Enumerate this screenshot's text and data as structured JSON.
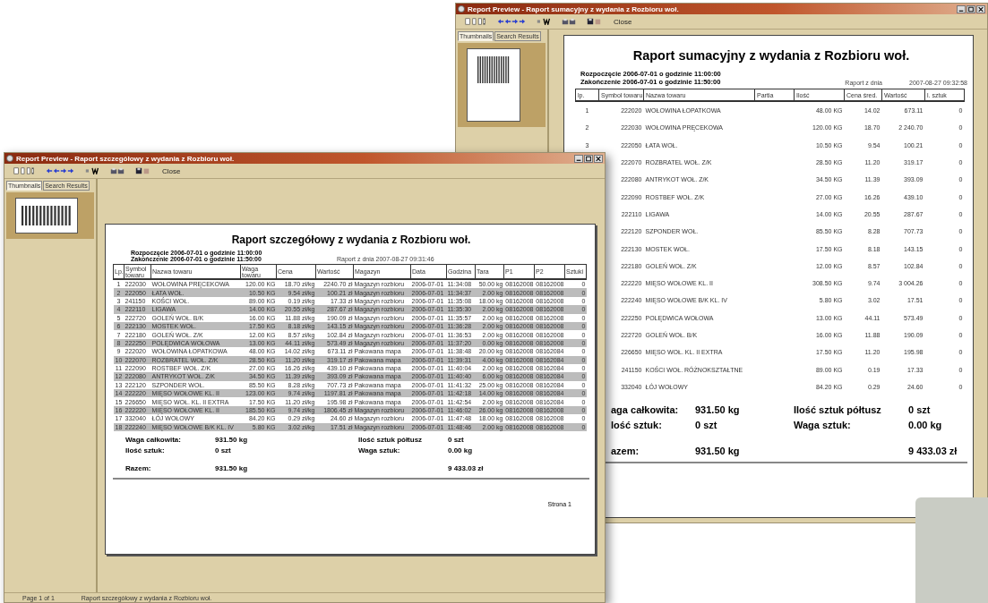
{
  "back_window": {
    "title": "Report Preview - Raport sumacyjny z wydania z Rozbioru woł.",
    "close_label": "Close",
    "tabs": [
      {
        "label": "Thumbnails",
        "selected": true
      },
      {
        "label": "Search Results",
        "selected": false
      }
    ],
    "report": {
      "title": "Raport sumacyjny z wydania z Rozbioru woł.",
      "start": "Rozpoczęcie 2006-07-01 o godzinie 11:00:00",
      "end": "Zakończenie 2006-07-01 o godzinie 11:50:00",
      "date_label": "Raport z dnia",
      "date": "2007-08-27 09:32:58",
      "columns": [
        "lp.",
        "Symbol towaru",
        "Nazwa towaru",
        "Partia",
        "Ilość",
        "Cena śred.",
        "Wartość",
        "l. sztuk"
      ],
      "rows": [
        [
          "1",
          "222020",
          "WOŁOWINA ŁOPATKOWA",
          "",
          "48.00 KG",
          "14.02",
          "673.11",
          "0"
        ],
        [
          "2",
          "222030",
          "WOŁOWINA PRĘCEKOWA",
          "",
          "120.00 KG",
          "18.70",
          "2 240.70",
          "0"
        ],
        [
          "3",
          "222050",
          "ŁATA WOŁ.",
          "",
          "10.50 KG",
          "9.54",
          "100.21",
          "0"
        ],
        [
          "",
          "222070",
          "ROZBRATEL WOŁ. Z/K",
          "",
          "28.50 KG",
          "11.20",
          "319.17",
          "0"
        ],
        [
          "",
          "222080",
          "ANTRYKOT WOŁ. Z/K",
          "",
          "34.50 KG",
          "11.39",
          "393.09",
          "0"
        ],
        [
          "",
          "222090",
          "ROSTBEF WOŁ. Z/K",
          "",
          "27.00 KG",
          "16.26",
          "439.10",
          "0"
        ],
        [
          "",
          "222110",
          "LIGAWA",
          "",
          "14.00 KG",
          "20.55",
          "287.67",
          "0"
        ],
        [
          "",
          "222120",
          "SZPONDER WOŁ.",
          "",
          "85.50 KG",
          "8.28",
          "707.73",
          "0"
        ],
        [
          "",
          "222130",
          "MOSTEK WOŁ.",
          "",
          "17.50 KG",
          "8.18",
          "143.15",
          "0"
        ],
        [
          "",
          "222180",
          "GOLEŃ WOŁ. Z/K",
          "",
          "12.00 KG",
          "8.57",
          "102.84",
          "0"
        ],
        [
          "",
          "222220",
          "MIĘSO WOŁOWE KL. II",
          "",
          "308.50 KG",
          "9.74",
          "3 004.26",
          "0"
        ],
        [
          "",
          "222240",
          "MIĘSO WOŁOWE B/K KL. IV",
          "",
          "5.80 KG",
          "3.02",
          "17.51",
          "0"
        ],
        [
          "",
          "222250",
          "POLĘDWICA WOŁOWA",
          "",
          "13.00 KG",
          "44.11",
          "573.49",
          "0"
        ],
        [
          "",
          "222720",
          "GOLEŃ WOŁ. B/K",
          "",
          "16.00 KG",
          "11.88",
          "190.09",
          "0"
        ],
        [
          "",
          "226650",
          "MIĘSO WOŁ. KL. II EXTRA",
          "",
          "17.50 KG",
          "11.20",
          "195.98",
          "0"
        ],
        [
          "",
          "241150",
          "KOŚCI WOŁ. RÓŻNOKSZTAŁTNE",
          "",
          "89.00 KG",
          "0.19",
          "17.33",
          "0"
        ],
        [
          "",
          "332040",
          "ŁÓJ WOŁOWY",
          "",
          "84.20 KG",
          "0.29",
          "24.60",
          "0"
        ]
      ],
      "summary": [
        {
          "left_label": "aga całkowita:",
          "left_value": "931.50 kg",
          "right_label": "Ilość sztuk półtusz",
          "right_value": "0 szt"
        },
        {
          "left_label": "lość sztuk:",
          "left_value": "0 szt",
          "right_label": "Waga sztuk:",
          "right_value": "0.00 kg"
        },
        {
          "left_label": "azem:",
          "left_value": "931.50 kg",
          "right_value": "9 433.03 zł"
        }
      ]
    }
  },
  "front_window": {
    "title": "Report Preview - Raport szczegółowy z wydania z Rozbioru woł.",
    "close_label": "Close",
    "tabs": [
      {
        "label": "Thumbnails",
        "selected": true
      },
      {
        "label": "Search Results",
        "selected": false
      }
    ],
    "report": {
      "title": "Raport szczegółowy z wydania z Rozbioru woł.",
      "start": "Rozpoczęcie 2006-07-01 o godzinie 11:00:00",
      "end": "Zakończenie 2006-07-01 o godzinie 11:50:00",
      "date_line": "Raport z dnia 2007-08-27 09:31:46",
      "columns": [
        "Lp.",
        "Symbol towaru",
        "Nazwa towaru",
        "Waga towaru",
        "Cena",
        "Wartość",
        "Magazyn",
        "Data",
        "Godzina",
        "Tara",
        "P1",
        "P2",
        "Sztuki"
      ],
      "rows": [
        [
          "1",
          "222030",
          "WOŁOWINA PRĘCEKOWA",
          "120.00 KG",
          "18.70 zł/kg",
          "2240.70 zł",
          "Magazyn rozbioru",
          "2006-07-01",
          "11:34:08",
          "50.00 kg",
          "08162008",
          "08162008",
          "0"
        ],
        [
          "2",
          "222050",
          "ŁATA WOŁ.",
          "10.50 KG",
          "9.54 zł/kg",
          "100.21 zł",
          "Magazyn rozbioru",
          "2006-07-01",
          "11:34:37",
          "2.00 kg",
          "08162008",
          "08162008",
          "0"
        ],
        [
          "3",
          "241150",
          "KOŚCI WOŁ.",
          "89.00 KG",
          "0.19 zł/kg",
          "17.33 zł",
          "Magazyn rozbioru",
          "2006-07-01",
          "11:35:08",
          "18.00 kg",
          "08162008",
          "08162008",
          "0"
        ],
        [
          "4",
          "222110",
          "LIGAWA",
          "14.00 KG",
          "20.55 zł/kg",
          "287.67 zł",
          "Magazyn rozbioru",
          "2006-07-01",
          "11:35:30",
          "2.00 kg",
          "08162008",
          "08162008",
          "0"
        ],
        [
          "5",
          "222720",
          "GOLEŃ WOŁ. B/K",
          "16.00 KG",
          "11.88 zł/kg",
          "190.09 zł",
          "Magazyn rozbioru",
          "2006-07-01",
          "11:35:57",
          "2.00 kg",
          "08162008",
          "08162008",
          "0"
        ],
        [
          "6",
          "222130",
          "MOSTEK WOŁ.",
          "17.50 KG",
          "8.18 zł/kg",
          "143.15 zł",
          "Magazyn rozbioru",
          "2006-07-01",
          "11:36:28",
          "2.00 kg",
          "08162008",
          "08162008",
          "0"
        ],
        [
          "7",
          "222180",
          "GOLEŃ WOŁ. Z/K",
          "12.00 KG",
          "8.57 zł/kg",
          "102.84 zł",
          "Magazyn rozbioru",
          "2006-07-01",
          "11:36:53",
          "2.00 kg",
          "08162008",
          "08162008",
          "0"
        ],
        [
          "8",
          "222250",
          "POLĘDWICA WOŁOWA",
          "13.00 KG",
          "44.11 zł/kg",
          "573.49 zł",
          "Magazyn rozbioru",
          "2006-07-01",
          "11:37:20",
          "0.00 kg",
          "08162008",
          "08162008",
          "0"
        ],
        [
          "9",
          "222020",
          "WOŁOWINA ŁOPATKOWA",
          "48.00 KG",
          "14.02 zł/kg",
          "673.11 zł",
          "Pakowana mapa",
          "2006-07-01",
          "11:38:48",
          "20.00 kg",
          "08162008",
          "08162084",
          "0"
        ],
        [
          "10",
          "222070",
          "ROZBRATEL WOŁ. Z/K",
          "28.50 KG",
          "11.20 zł/kg",
          "319.17 zł",
          "Pakowana mapa",
          "2006-07-01",
          "11:39:31",
          "4.00 kg",
          "08162008",
          "08162084",
          "0"
        ],
        [
          "11",
          "222090",
          "ROSTBEF WOŁ. Z/K",
          "27.00 KG",
          "16.26 zł/kg",
          "439.10 zł",
          "Pakowana mapa",
          "2006-07-01",
          "11:40:04",
          "2.00 kg",
          "08162008",
          "08162084",
          "0"
        ],
        [
          "12",
          "222080",
          "ANTRYKOT WOŁ. Z/K",
          "34.50 KG",
          "11.39 zł/kg",
          "393.09 zł",
          "Pakowana mapa",
          "2006-07-01",
          "11:40:40",
          "6.00 kg",
          "08162008",
          "08162084",
          "0"
        ],
        [
          "13",
          "222120",
          "SZPONDER WOŁ.",
          "85.50 KG",
          "8.28 zł/kg",
          "707.73 zł",
          "Pakowana mapa",
          "2006-07-01",
          "11:41:32",
          "25.00 kg",
          "08162008",
          "08162084",
          "0"
        ],
        [
          "14",
          "222220",
          "MIĘSO WOŁOWE KL. II",
          "123.00 KG",
          "9.74 zł/kg",
          "1197.81 zł",
          "Pakowana mapa",
          "2006-07-01",
          "11:42:18",
          "14.00 kg",
          "08162008",
          "08162084",
          "0"
        ],
        [
          "15",
          "226650",
          "MIĘSO WOŁ. KL. II EXTRA",
          "17.50 KG",
          "11.20 zł/kg",
          "195.98 zł",
          "Pakowana mapa",
          "2006-07-01",
          "11:42:54",
          "2.00 kg",
          "08162008",
          "08162084",
          "0"
        ],
        [
          "16",
          "222220",
          "MIĘSO WOŁOWE KL. II",
          "185.50 KG",
          "9.74 zł/kg",
          "1806.45 zł",
          "Magazyn rozbioru",
          "2006-07-01",
          "11:46:02",
          "26.00 kg",
          "08162008",
          "08162008",
          "0"
        ],
        [
          "17",
          "332040",
          "ŁÓJ WOŁOWY",
          "84.20 KG",
          "0.29 zł/kg",
          "24.60 zł",
          "Magazyn rozbioru",
          "2006-07-01",
          "11:47:48",
          "18.00 kg",
          "08162008",
          "08162008",
          "0"
        ],
        [
          "18",
          "222240",
          "MIĘSO WOŁOWE B/K KL. IV",
          "5.80 KG",
          "3.02 zł/kg",
          "17.51 zł",
          "Magazyn rozbioru",
          "2006-07-01",
          "11:48:46",
          "2.00 kg",
          "08162008",
          "08162008",
          "0"
        ]
      ],
      "summary": [
        {
          "left_label": "Waga całkowita:",
          "left_value": "931.50 kg",
          "right_label": "Ilość sztuk półtusz",
          "right_value": "0 szt"
        },
        {
          "left_label": "Ilość sztuk:",
          "left_value": "0 szt",
          "right_label": "Waga sztuk:",
          "right_value": "0.00 kg"
        },
        {
          "left_label": "Razem:",
          "left_value": "931.50 kg",
          "right_value": "9 433.03 zł"
        }
      ],
      "footer": "Strona 1"
    },
    "status_bar": [
      "Page 1 of 1",
      "Raport szczegółowy z wydania z Rozbioru woł."
    ]
  }
}
